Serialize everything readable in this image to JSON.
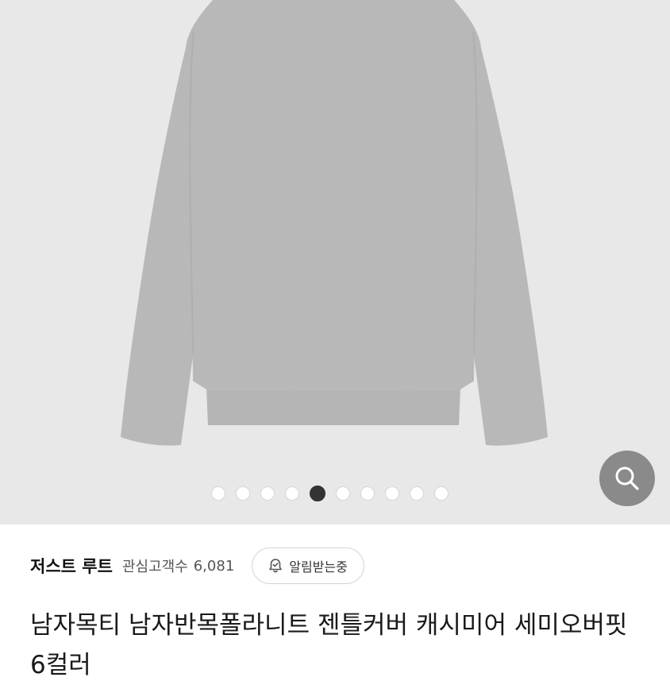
{
  "gallery": {
    "image_alt": "gray knit sweater",
    "image_count": 10,
    "active_index": 4,
    "background": "#e8e8e8",
    "product_color": "#b5b5b5"
  },
  "search_fab": {
    "icon": "search-icon",
    "color": "#8a8a8a"
  },
  "store": {
    "name": "저스트 루트",
    "follower_label": "관심고객수",
    "follower_count": "6,081",
    "notify_icon": "bell-check-icon",
    "notify_label": "알림받는중"
  },
  "product": {
    "title": "남자목티 남자반목폴라니트 젠틀커버 캐시미어 세미오버핏 6컬러"
  }
}
